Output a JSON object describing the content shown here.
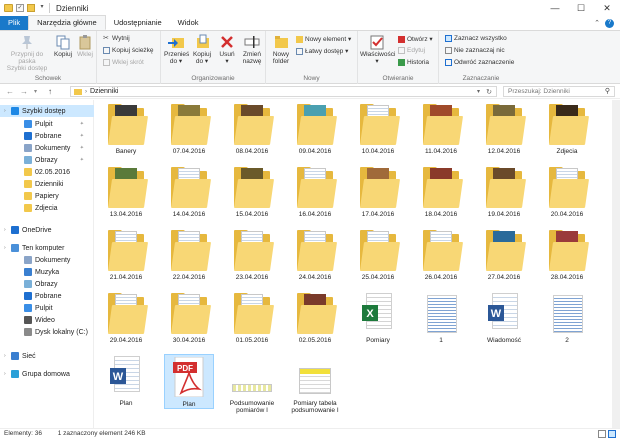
{
  "window": {
    "title": "Dzienniki"
  },
  "tabs": [
    {
      "label": "Plik",
      "kind": "file"
    },
    {
      "label": "Narzędzia główne",
      "kind": "active"
    },
    {
      "label": "Udostępnianie",
      "kind": ""
    },
    {
      "label": "Widok",
      "kind": ""
    }
  ],
  "ribbon": {
    "schowek": {
      "label": "Schowek",
      "pin": "Przypnij do paska\nSzybki dostęp",
      "copy": "Kopiuj",
      "paste": "Wklej",
      "cut": "Wytnij",
      "copy_path": "Kopiuj ścieżkę",
      "paste_shortcut": "Wklej skrót"
    },
    "organizowanie": {
      "label": "Organizowanie",
      "move": "Przenieś\ndo ▾",
      "copyto": "Kopiuj\ndo ▾",
      "delete": "Usuń\n▾",
      "rename": "Zmień\nnazwę"
    },
    "nowy": {
      "label": "Nowy",
      "new_folder": "Nowy\nfolder",
      "new_element": "Nowy element ▾",
      "easy_access": "Łatwy dostęp ▾"
    },
    "otwieranie": {
      "label": "Otwieranie",
      "properties": "Właściwości\n▾",
      "open": "Otwórz ▾",
      "edit": "Edytuj",
      "history": "Historia"
    },
    "zaznaczanie": {
      "label": "Zaznaczanie",
      "select_all": "Zaznacz wszystko",
      "select_none": "Nie zaznaczaj nic",
      "invert": "Odwróć zaznaczenie"
    }
  },
  "address": {
    "path": "Dzienniki",
    "search_placeholder": "Przeszukaj: Dzienniki"
  },
  "nav": [
    {
      "label": "Szybki dostęp",
      "icon": "star-icon",
      "color": "#1e88e5",
      "indent": 0,
      "pin": false,
      "sel": true,
      "exp": true
    },
    {
      "label": "Pulpit",
      "icon": "desktop-icon",
      "color": "#3a8ee6",
      "indent": 1,
      "pin": true,
      "sel": false,
      "exp": false
    },
    {
      "label": "Pobrane",
      "icon": "download-icon",
      "color": "#1e6fd0",
      "indent": 1,
      "pin": true,
      "sel": false,
      "exp": false
    },
    {
      "label": "Dokumenty",
      "icon": "documents-icon",
      "color": "#8aa4c8",
      "indent": 1,
      "pin": true,
      "sel": false,
      "exp": false
    },
    {
      "label": "Obrazy",
      "icon": "pictures-icon",
      "color": "#7ab0d8",
      "indent": 1,
      "pin": true,
      "sel": false,
      "exp": false
    },
    {
      "label": "02.05.2016",
      "icon": "folder-icon",
      "color": "#f2c84b",
      "indent": 1,
      "pin": false,
      "sel": false,
      "exp": false
    },
    {
      "label": "Dzienniki",
      "icon": "folder-icon",
      "color": "#f2c84b",
      "indent": 1,
      "pin": false,
      "sel": false,
      "exp": false
    },
    {
      "label": "Papiery",
      "icon": "folder-icon",
      "color": "#f2c84b",
      "indent": 1,
      "pin": false,
      "sel": false,
      "exp": false
    },
    {
      "label": "Zdjecia",
      "icon": "folder-icon",
      "color": "#f2c84b",
      "indent": 1,
      "pin": false,
      "sel": false,
      "exp": false
    },
    {
      "label": "OneDrive",
      "icon": "cloud-icon",
      "color": "#1e6fd0",
      "indent": 0,
      "pin": false,
      "sel": false,
      "exp": true
    },
    {
      "label": "Ten komputer",
      "icon": "computer-icon",
      "color": "#4a90d9",
      "indent": 0,
      "pin": false,
      "sel": false,
      "exp": true
    },
    {
      "label": "Dokumenty",
      "icon": "documents-icon",
      "color": "#8aa4c8",
      "indent": 1,
      "pin": false,
      "sel": false,
      "exp": false
    },
    {
      "label": "Muzyka",
      "icon": "music-icon",
      "color": "#3a7fd0",
      "indent": 1,
      "pin": false,
      "sel": false,
      "exp": false
    },
    {
      "label": "Obrazy",
      "icon": "pictures-icon",
      "color": "#7ab0d8",
      "indent": 1,
      "pin": false,
      "sel": false,
      "exp": false
    },
    {
      "label": "Pobrane",
      "icon": "download-icon",
      "color": "#1e6fd0",
      "indent": 1,
      "pin": false,
      "sel": false,
      "exp": false
    },
    {
      "label": "Pulpit",
      "icon": "desktop-icon",
      "color": "#3a8ee6",
      "indent": 1,
      "pin": false,
      "sel": false,
      "exp": false
    },
    {
      "label": "Wideo",
      "icon": "video-icon",
      "color": "#555555",
      "indent": 1,
      "pin": false,
      "sel": false,
      "exp": false
    },
    {
      "label": "Dysk lokalny (C:)",
      "icon": "drive-icon",
      "color": "#8a8a8a",
      "indent": 1,
      "pin": false,
      "sel": false,
      "exp": false
    },
    {
      "label": "Sieć",
      "icon": "network-icon",
      "color": "#3a7fd0",
      "indent": 0,
      "pin": false,
      "sel": false,
      "exp": true
    },
    {
      "label": "Grupa domowa",
      "icon": "homegroup-icon",
      "color": "#2aa0d8",
      "indent": 0,
      "pin": false,
      "sel": false,
      "exp": true
    }
  ],
  "files": [
    {
      "name": "Banery",
      "type": "folder",
      "preview": "#3a3a3a"
    },
    {
      "name": "07.04.2016",
      "type": "folder",
      "preview": "#8a7a3a"
    },
    {
      "name": "08.04.2016",
      "type": "folder",
      "preview": "#6a4a2a"
    },
    {
      "name": "09.04.2016",
      "type": "folder",
      "preview": "#4aa0b0"
    },
    {
      "name": "10.04.2016",
      "type": "folder",
      "preview": "doc"
    },
    {
      "name": "11.04.2016",
      "type": "folder",
      "preview": "#a04a2a"
    },
    {
      "name": "12.04.2016",
      "type": "folder",
      "preview": "#7a6a3a"
    },
    {
      "name": "Zdjecia",
      "type": "folder",
      "preview": "#3a2a1a"
    },
    {
      "name": "13.04.2016",
      "type": "folder",
      "preview": "#5a7a3a"
    },
    {
      "name": "14.04.2016",
      "type": "folder",
      "preview": "doc"
    },
    {
      "name": "15.04.2016",
      "type": "folder",
      "preview": "#6a5a2a"
    },
    {
      "name": "16.04.2016",
      "type": "folder",
      "preview": "doc"
    },
    {
      "name": "17.04.2016",
      "type": "folder",
      "preview": "#a06a3a"
    },
    {
      "name": "18.04.2016",
      "type": "folder",
      "preview": "#8a3a2a"
    },
    {
      "name": "19.04.2016",
      "type": "folder",
      "preview": "#6a4a2a"
    },
    {
      "name": "20.04.2016",
      "type": "folder",
      "preview": "doc"
    },
    {
      "name": "21.04.2016",
      "type": "folder",
      "preview": "doc"
    },
    {
      "name": "22.04.2016",
      "type": "folder",
      "preview": "doc"
    },
    {
      "name": "23.04.2016",
      "type": "folder",
      "preview": "doc"
    },
    {
      "name": "24.04.2016",
      "type": "folder",
      "preview": "doc"
    },
    {
      "name": "25.04.2016",
      "type": "folder",
      "preview": "doc"
    },
    {
      "name": "26.04.2016",
      "type": "folder",
      "preview": "doc"
    },
    {
      "name": "27.04.2016",
      "type": "folder",
      "preview": "#2a6a9a"
    },
    {
      "name": "28.04.2016",
      "type": "folder",
      "preview": "#9a3a3a"
    },
    {
      "name": "29.04.2016",
      "type": "folder",
      "preview": "doc"
    },
    {
      "name": "30.04.2016",
      "type": "folder",
      "preview": "doc"
    },
    {
      "name": "01.05.2016",
      "type": "folder",
      "preview": "doc"
    },
    {
      "name": "02.05.2016",
      "type": "folder",
      "preview": "#7a3a2a"
    },
    {
      "name": "Pomiary",
      "type": "excel",
      "preview": ""
    },
    {
      "name": "1",
      "type": "sheet",
      "preview": ""
    },
    {
      "name": "Wiadomość",
      "type": "word",
      "preview": ""
    },
    {
      "name": "2",
      "type": "sheet",
      "preview": ""
    },
    {
      "name": "Plan",
      "type": "word",
      "preview": ""
    },
    {
      "name": "Plan",
      "type": "pdf",
      "preview": "",
      "sel": true
    },
    {
      "name": "Podsumowanie pomiarów I",
      "type": "strip",
      "preview": ""
    },
    {
      "name": "Pomiary tabela podsumowanie I",
      "type": "table",
      "preview": ""
    }
  ],
  "status": {
    "count": "Elementy: 36",
    "selected": "1 zaznaczony element  246 KB"
  },
  "colors": {
    "accent": "#1979ca",
    "selection": "#cce8ff",
    "folder": "#f2c84b"
  }
}
